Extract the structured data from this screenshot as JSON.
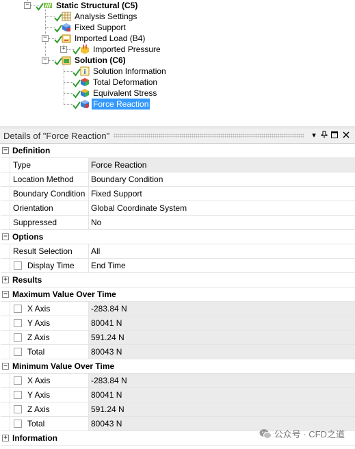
{
  "tree": {
    "nodes": [
      {
        "label": "Static Structural (C5)",
        "bold": true
      },
      {
        "label": "Analysis Settings"
      },
      {
        "label": "Fixed Support"
      },
      {
        "label": "Imported Load (B4)"
      },
      {
        "label": "Imported Pressure"
      },
      {
        "label": "Solution (C6)",
        "bold": true
      },
      {
        "label": "Solution Information"
      },
      {
        "label": "Total Deformation"
      },
      {
        "label": "Equivalent Stress"
      },
      {
        "label": "Force Reaction",
        "selected": true
      }
    ]
  },
  "details": {
    "title": "Details of \"Force Reaction\"",
    "buttons": {
      "dropdown": "▾",
      "pin": "⊥",
      "restore": "□",
      "close": "✕"
    },
    "sections": [
      {
        "name": "Definition",
        "expanded": true,
        "rows": [
          {
            "name": "Type",
            "value": "Force Reaction",
            "readonly": true
          },
          {
            "name": "Location Method",
            "value": "Boundary Condition"
          },
          {
            "name": "Boundary Condition",
            "value": "Fixed Support"
          },
          {
            "name": "Orientation",
            "value": "Global Coordinate System"
          },
          {
            "name": "Suppressed",
            "value": "No"
          }
        ]
      },
      {
        "name": "Options",
        "expanded": true,
        "rows": [
          {
            "name": "Result Selection",
            "value": "All"
          },
          {
            "name": "Display Time",
            "value": "End Time",
            "checkbox": true
          }
        ]
      },
      {
        "name": "Results",
        "expanded": false,
        "rows": []
      },
      {
        "name": "Maximum Value Over Time",
        "expanded": true,
        "rows": [
          {
            "name": "X Axis",
            "value": "-283.84 N",
            "checkbox": true,
            "readonly": true
          },
          {
            "name": "Y Axis",
            "value": "80041 N",
            "checkbox": true,
            "readonly": true
          },
          {
            "name": "Z Axis",
            "value": "591.24 N",
            "checkbox": true,
            "readonly": true
          },
          {
            "name": "Total",
            "value": "80043 N",
            "checkbox": true,
            "readonly": true
          }
        ]
      },
      {
        "name": "Minimum Value Over Time",
        "expanded": true,
        "rows": [
          {
            "name": "X Axis",
            "value": "-283.84 N",
            "checkbox": true,
            "readonly": true
          },
          {
            "name": "Y Axis",
            "value": "80041 N",
            "checkbox": true,
            "readonly": true
          },
          {
            "name": "Z Axis",
            "value": "591.24 N",
            "checkbox": true,
            "readonly": true
          },
          {
            "name": "Total",
            "value": "80043 N",
            "checkbox": true,
            "readonly": true
          }
        ]
      },
      {
        "name": "Information",
        "expanded": false,
        "rows": []
      }
    ]
  },
  "watermark": {
    "text": "公众号 · CFD之道"
  },
  "colors": {
    "selection": "#3399ff",
    "check": "#2e9d2e",
    "readonly_bg": "#ebebeb"
  }
}
